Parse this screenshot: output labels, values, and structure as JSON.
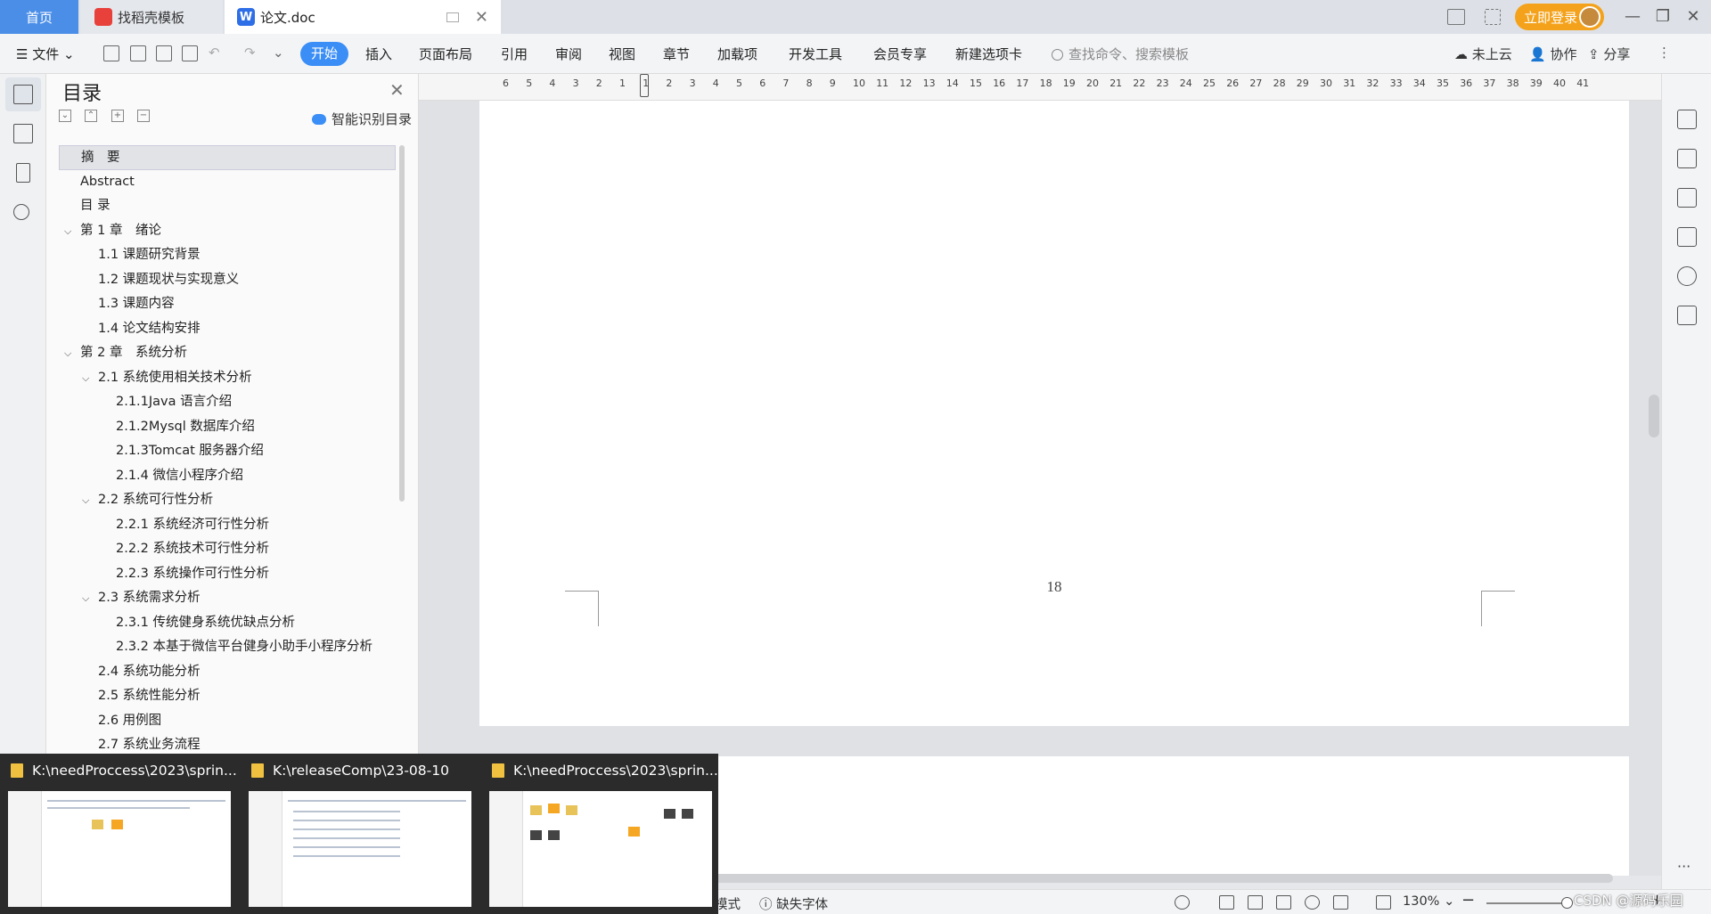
{
  "tabs": {
    "home": "首页",
    "template": "找稻壳模板",
    "doc": "论文.doc"
  },
  "titlebar": {
    "login": "立即登录"
  },
  "ribbon": {
    "file": "文件",
    "items": [
      "开始",
      "插入",
      "页面布局",
      "引用",
      "审阅",
      "视图",
      "章节",
      "加载项",
      "开发工具",
      "会员专享",
      "新建选项卡"
    ],
    "search_placeholder": "查找命令、搜索模板",
    "cloud": "未上云",
    "collab": "协作",
    "share": "分享"
  },
  "toc": {
    "title": "目录",
    "smart": "智能识别目录",
    "items": [
      {
        "text": "摘　要",
        "level": 0,
        "selected": true
      },
      {
        "text": "Abstract",
        "level": 0
      },
      {
        "text": "目  录",
        "level": 0
      },
      {
        "text": "第 1 章　绪论",
        "level": 0,
        "chev": true
      },
      {
        "text": "1.1 课题研究背景",
        "level": 1
      },
      {
        "text": "1.2 课题现状与实现意义",
        "level": 1
      },
      {
        "text": "1.3 课题内容",
        "level": 1
      },
      {
        "text": "1.4 论文结构安排",
        "level": 1
      },
      {
        "text": "第 2 章　系统分析",
        "level": 0,
        "chev": true
      },
      {
        "text": "2.1 系统使用相关技术分析",
        "level": 1,
        "chev": true
      },
      {
        "text": "2.1.1Java 语言介绍",
        "level": 2
      },
      {
        "text": "2.1.2Mysql 数据库介绍",
        "level": 2
      },
      {
        "text": "2.1.3Tomcat 服务器介绍",
        "level": 2
      },
      {
        "text": "2.1.4 微信小程序介绍",
        "level": 2
      },
      {
        "text": "2.2 系统可行性分析",
        "level": 1,
        "chev": true
      },
      {
        "text": "2.2.1 系统经济可行性分析",
        "level": 2
      },
      {
        "text": "2.2.2 系统技术可行性分析",
        "level": 2
      },
      {
        "text": "2.2.3 系统操作可行性分析",
        "level": 2
      },
      {
        "text": "2.3 系统需求分析",
        "level": 1,
        "chev": true
      },
      {
        "text": "2.3.1 传统健身系统优缺点分析",
        "level": 2
      },
      {
        "text": "2.3.2 本基于微信平台健身小助手小程序分析",
        "level": 2
      },
      {
        "text": "2.4 系统功能分析",
        "level": 1
      },
      {
        "text": "2.5 系统性能分析",
        "level": 1
      },
      {
        "text": "2.6 用例图",
        "level": 1
      },
      {
        "text": "2.7 系统业务流程",
        "level": 1
      }
    ]
  },
  "ruler": {
    "numbers": [
      "6",
      "5",
      "4",
      "3",
      "2",
      "1",
      "1",
      "2",
      "3",
      "4",
      "5",
      "6",
      "7",
      "8",
      "9",
      "10",
      "11",
      "12",
      "13",
      "14",
      "15",
      "16",
      "17",
      "18",
      "19",
      "20",
      "21",
      "22",
      "23",
      "24",
      "25",
      "26",
      "27",
      "28",
      "29",
      "30",
      "31",
      "32",
      "33",
      "34",
      "35",
      "36",
      "37",
      "38",
      "39",
      "40",
      "41"
    ]
  },
  "document": {
    "page_number": "18"
  },
  "statusbar": {
    "mode_fragment": "模式",
    "missing_font": "缺失字体",
    "zoom": "130%"
  },
  "taskbar_preview": {
    "windows": [
      "K:\\needProccess\\2023\\sprin...",
      "K:\\releaseComp\\23-08-10",
      "K:\\needProccess\\2023\\sprin..."
    ]
  },
  "watermark": "CSDN @源码乐园"
}
